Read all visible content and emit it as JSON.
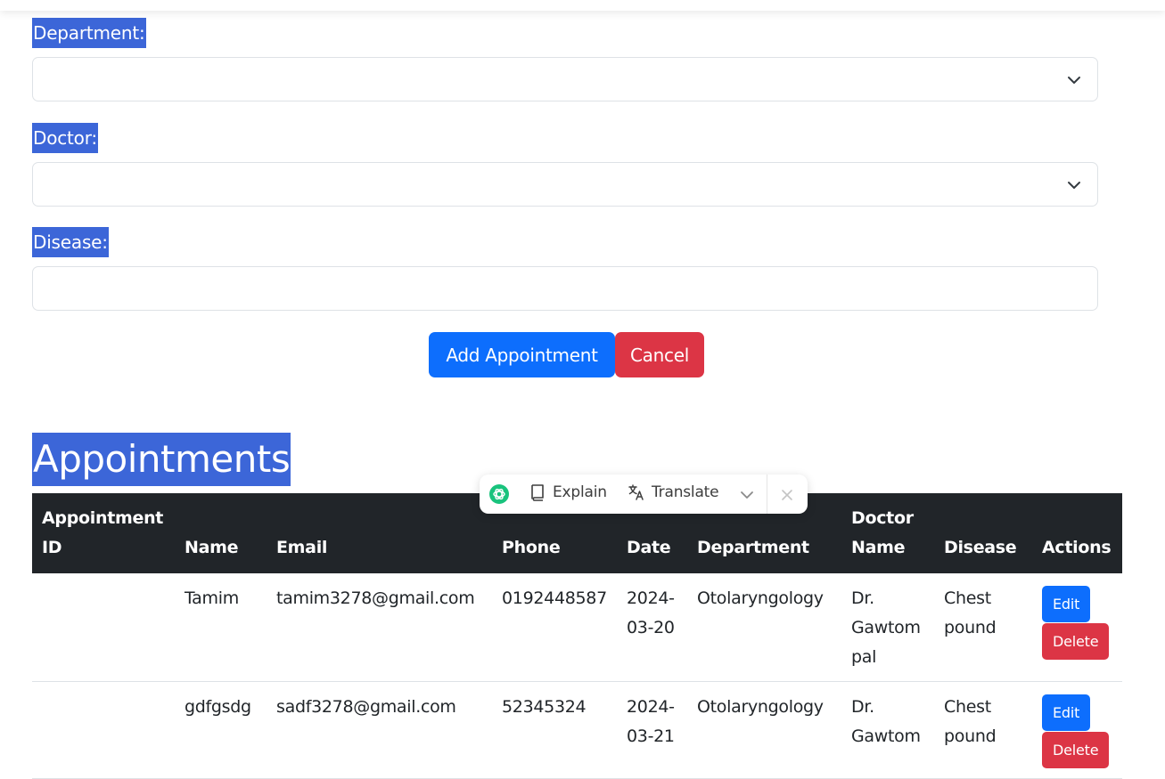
{
  "form": {
    "department_label": "Department:",
    "department_value": "",
    "doctor_label": "Doctor:",
    "doctor_value": "",
    "disease_label": "Disease:",
    "disease_value": "",
    "add_button": "Add Appointment",
    "cancel_button": "Cancel"
  },
  "appointments": {
    "title": "Appointments",
    "columns": [
      "Appointment ID",
      "Name",
      "Email",
      "Phone",
      "Date",
      "Department",
      "Doctor Name",
      "Disease",
      "Actions"
    ],
    "rows": [
      {
        "id": "",
        "name": "Tamim",
        "email": "tamim3278@gmail.com",
        "phone": "0192448587",
        "date": "2024-03-20",
        "department": "Otolaryngology",
        "doctor": "Dr. Gawtom pal",
        "disease": "Chest pound"
      },
      {
        "id": "",
        "name": "gdfgsdg",
        "email": "sadf3278@gmail.com",
        "phone": "52345324",
        "date": "2024-03-21",
        "department": "Otolaryngology",
        "doctor": "Dr. Gawtom",
        "disease": "Chest pound"
      }
    ],
    "edit_label": "Edit",
    "delete_label": "Delete"
  },
  "selection_popup": {
    "explain": "Explain",
    "translate": "Translate",
    "icons": [
      "chatgpt-icon",
      "book-icon",
      "translate-icon",
      "chevron-down-icon",
      "close-icon"
    ]
  },
  "colors": {
    "primary": "#0d6efd",
    "danger": "#dc3545",
    "selection": "#3c66d8",
    "table_header": "#212529"
  }
}
